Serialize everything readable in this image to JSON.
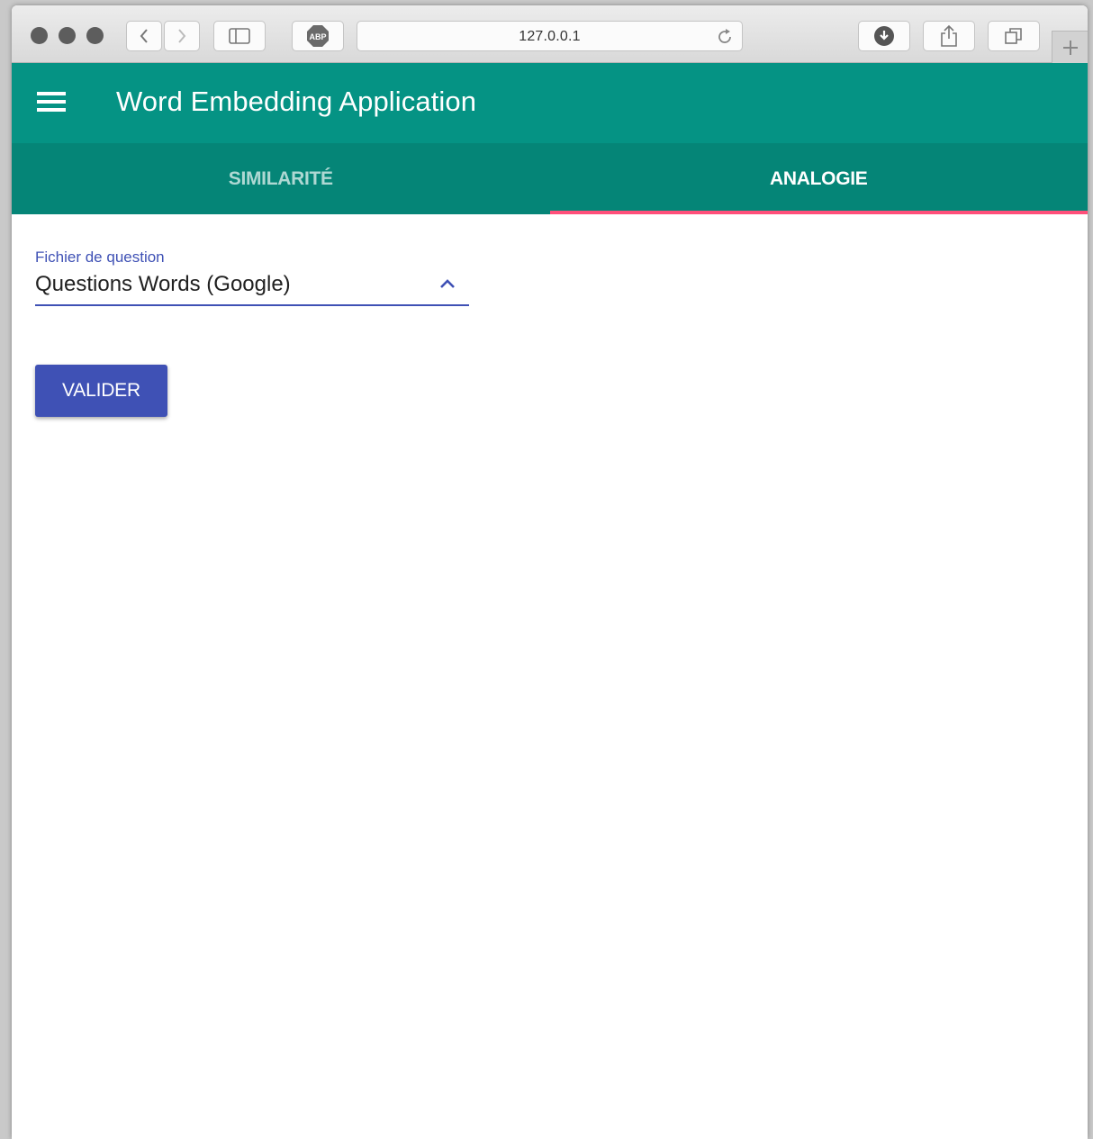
{
  "browser": {
    "url": "127.0.0.1"
  },
  "app": {
    "title": "Word Embedding Application"
  },
  "tabs": [
    {
      "label": "SIMILARITÉ",
      "active": false
    },
    {
      "label": "ANALOGIE",
      "active": true
    }
  ],
  "form": {
    "question_file_label": "Fichier de question",
    "question_file_value": "Questions Words (Google)",
    "submit_label": "VALIDER"
  },
  "colors": {
    "appbar": "#059384",
    "tabbar": "#058577",
    "tab_indicator": "#ff4f7a",
    "primary": "#3f51b5"
  }
}
